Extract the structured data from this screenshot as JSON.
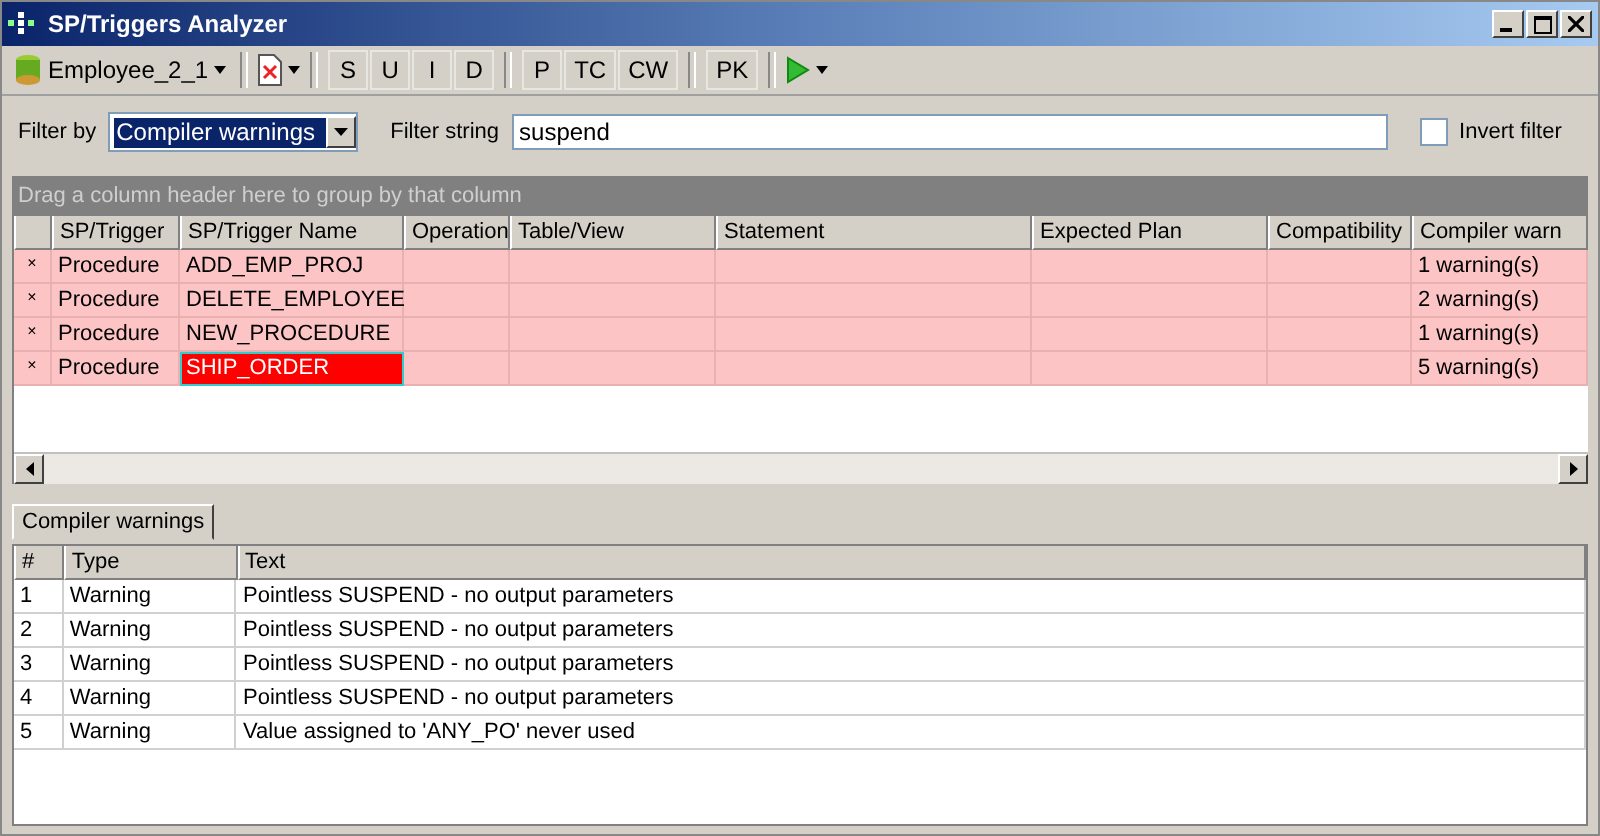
{
  "window": {
    "title": "SP/Triggers Analyzer"
  },
  "toolbar": {
    "database": "Employee_2_1",
    "toggles": [
      [
        "S",
        "U",
        "I",
        "D"
      ],
      [
        "P",
        "TC",
        "CW"
      ],
      [
        "PK"
      ]
    ]
  },
  "filter": {
    "by_label": "Filter by",
    "by_value": "Compiler warnings",
    "string_label": "Filter string",
    "string_value": "suspend",
    "invert_label": "Invert filter",
    "invert_checked": false
  },
  "group_hint": "Drag a column header here to group by that column",
  "table": {
    "columns": [
      "SP/Trigger",
      "SP/Trigger Name",
      "Operation",
      "Table/View",
      "Statement",
      "Expected Plan",
      "Compatibility",
      "Compiler warn"
    ],
    "rows": [
      {
        "marker": "×",
        "type": "Procedure",
        "name": "ADD_EMP_PROJ",
        "warnings": "1 warning(s)",
        "selected": false
      },
      {
        "marker": "×",
        "type": "Procedure",
        "name": "DELETE_EMPLOYEE",
        "warnings": "2 warning(s)",
        "selected": false
      },
      {
        "marker": "×",
        "type": "Procedure",
        "name": "NEW_PROCEDURE",
        "warnings": "1 warning(s)",
        "selected": false
      },
      {
        "marker": "×",
        "type": "Procedure",
        "name": "SHIP_ORDER",
        "warnings": "5 warning(s)",
        "selected": true
      }
    ]
  },
  "bottom_tab": "Compiler warnings",
  "warnings": {
    "columns": [
      "#",
      "Type",
      "Text"
    ],
    "rows": [
      [
        "1",
        "Warning",
        "Pointless SUSPEND - no output parameters"
      ],
      [
        "2",
        "Warning",
        "Pointless SUSPEND - no output parameters"
      ],
      [
        "3",
        "Warning",
        "Pointless SUSPEND - no output parameters"
      ],
      [
        "4",
        "Warning",
        "Pointless SUSPEND - no output parameters"
      ],
      [
        "5",
        "Warning",
        "Value assigned to 'ANY_PO' never used"
      ]
    ]
  }
}
